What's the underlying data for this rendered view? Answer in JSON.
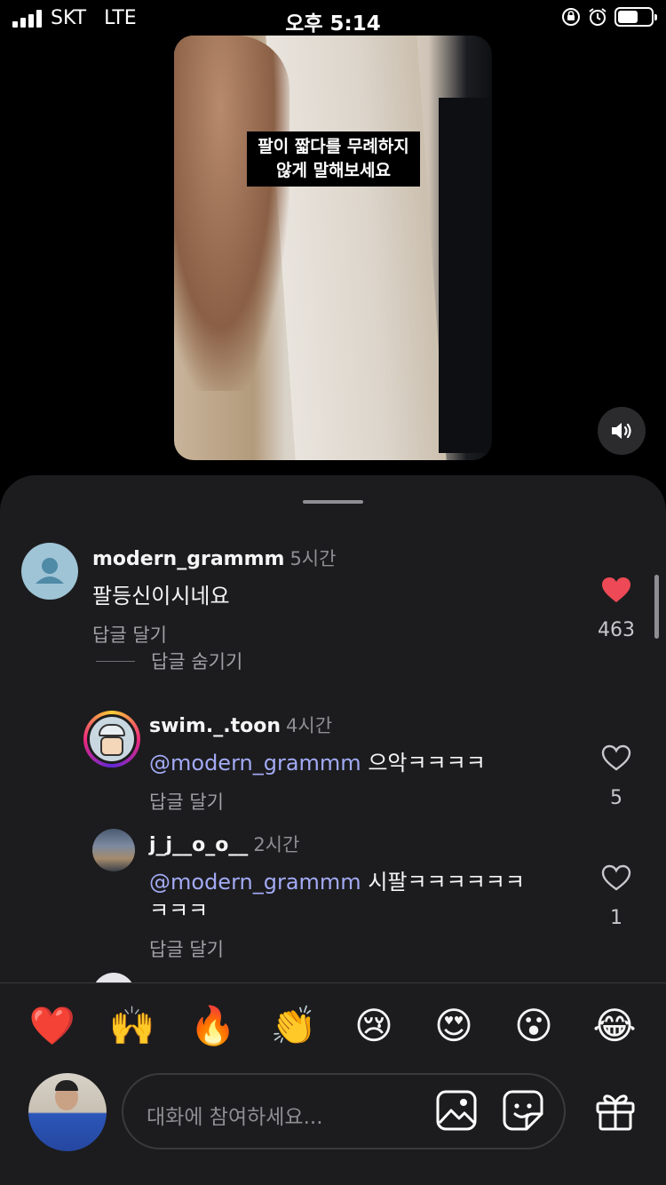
{
  "status_bar": {
    "carrier": "SKT",
    "network": "LTE",
    "time": "오후 5:14"
  },
  "video": {
    "caption_line1": "팔이 짧다를 무례하지",
    "caption_line2": "않게 말해보세요"
  },
  "comments": [
    {
      "username": "modern_grammm",
      "time": "5시간",
      "text": "팔등신이시네요",
      "reply_label": "답글 달기",
      "hide_replies_label": "답글 숨기기",
      "likes": "463",
      "liked": true
    },
    {
      "username": "swim._.toon",
      "time": "4시간",
      "mention": "@modern_grammm",
      "text": "으악ㅋㅋㅋㅋ",
      "reply_label": "답글 달기",
      "likes": "5",
      "liked": false
    },
    {
      "username": "j_j__o_o__",
      "time": "2시간",
      "mention": "@modern_grammm",
      "text_line1": "시팔ㅋㅋㅋㅋㅋㅋ",
      "text_line2": "ㅋㅋㅋ",
      "reply_label": "답글 달기",
      "likes": "1",
      "liked": false
    }
  ],
  "emojis": [
    {
      "name": "heart-emoji",
      "char": "❤️"
    },
    {
      "name": "raised-hands-emoji",
      "char": "🙌"
    },
    {
      "name": "fire-emoji",
      "char": "🔥"
    },
    {
      "name": "clapping-emoji",
      "char": "👏"
    },
    {
      "name": "crying-emoji",
      "char": "😢"
    },
    {
      "name": "heart-eyes-emoji",
      "char": "😍"
    },
    {
      "name": "surprised-emoji",
      "char": "😮"
    },
    {
      "name": "laughing-emoji",
      "char": "😂"
    }
  ],
  "input": {
    "placeholder": "대화에 참여하세요..."
  },
  "colors": {
    "sheet_bg": "#1c1c1e",
    "mention": "#a3aaf5",
    "like_red": "#ed4956"
  }
}
